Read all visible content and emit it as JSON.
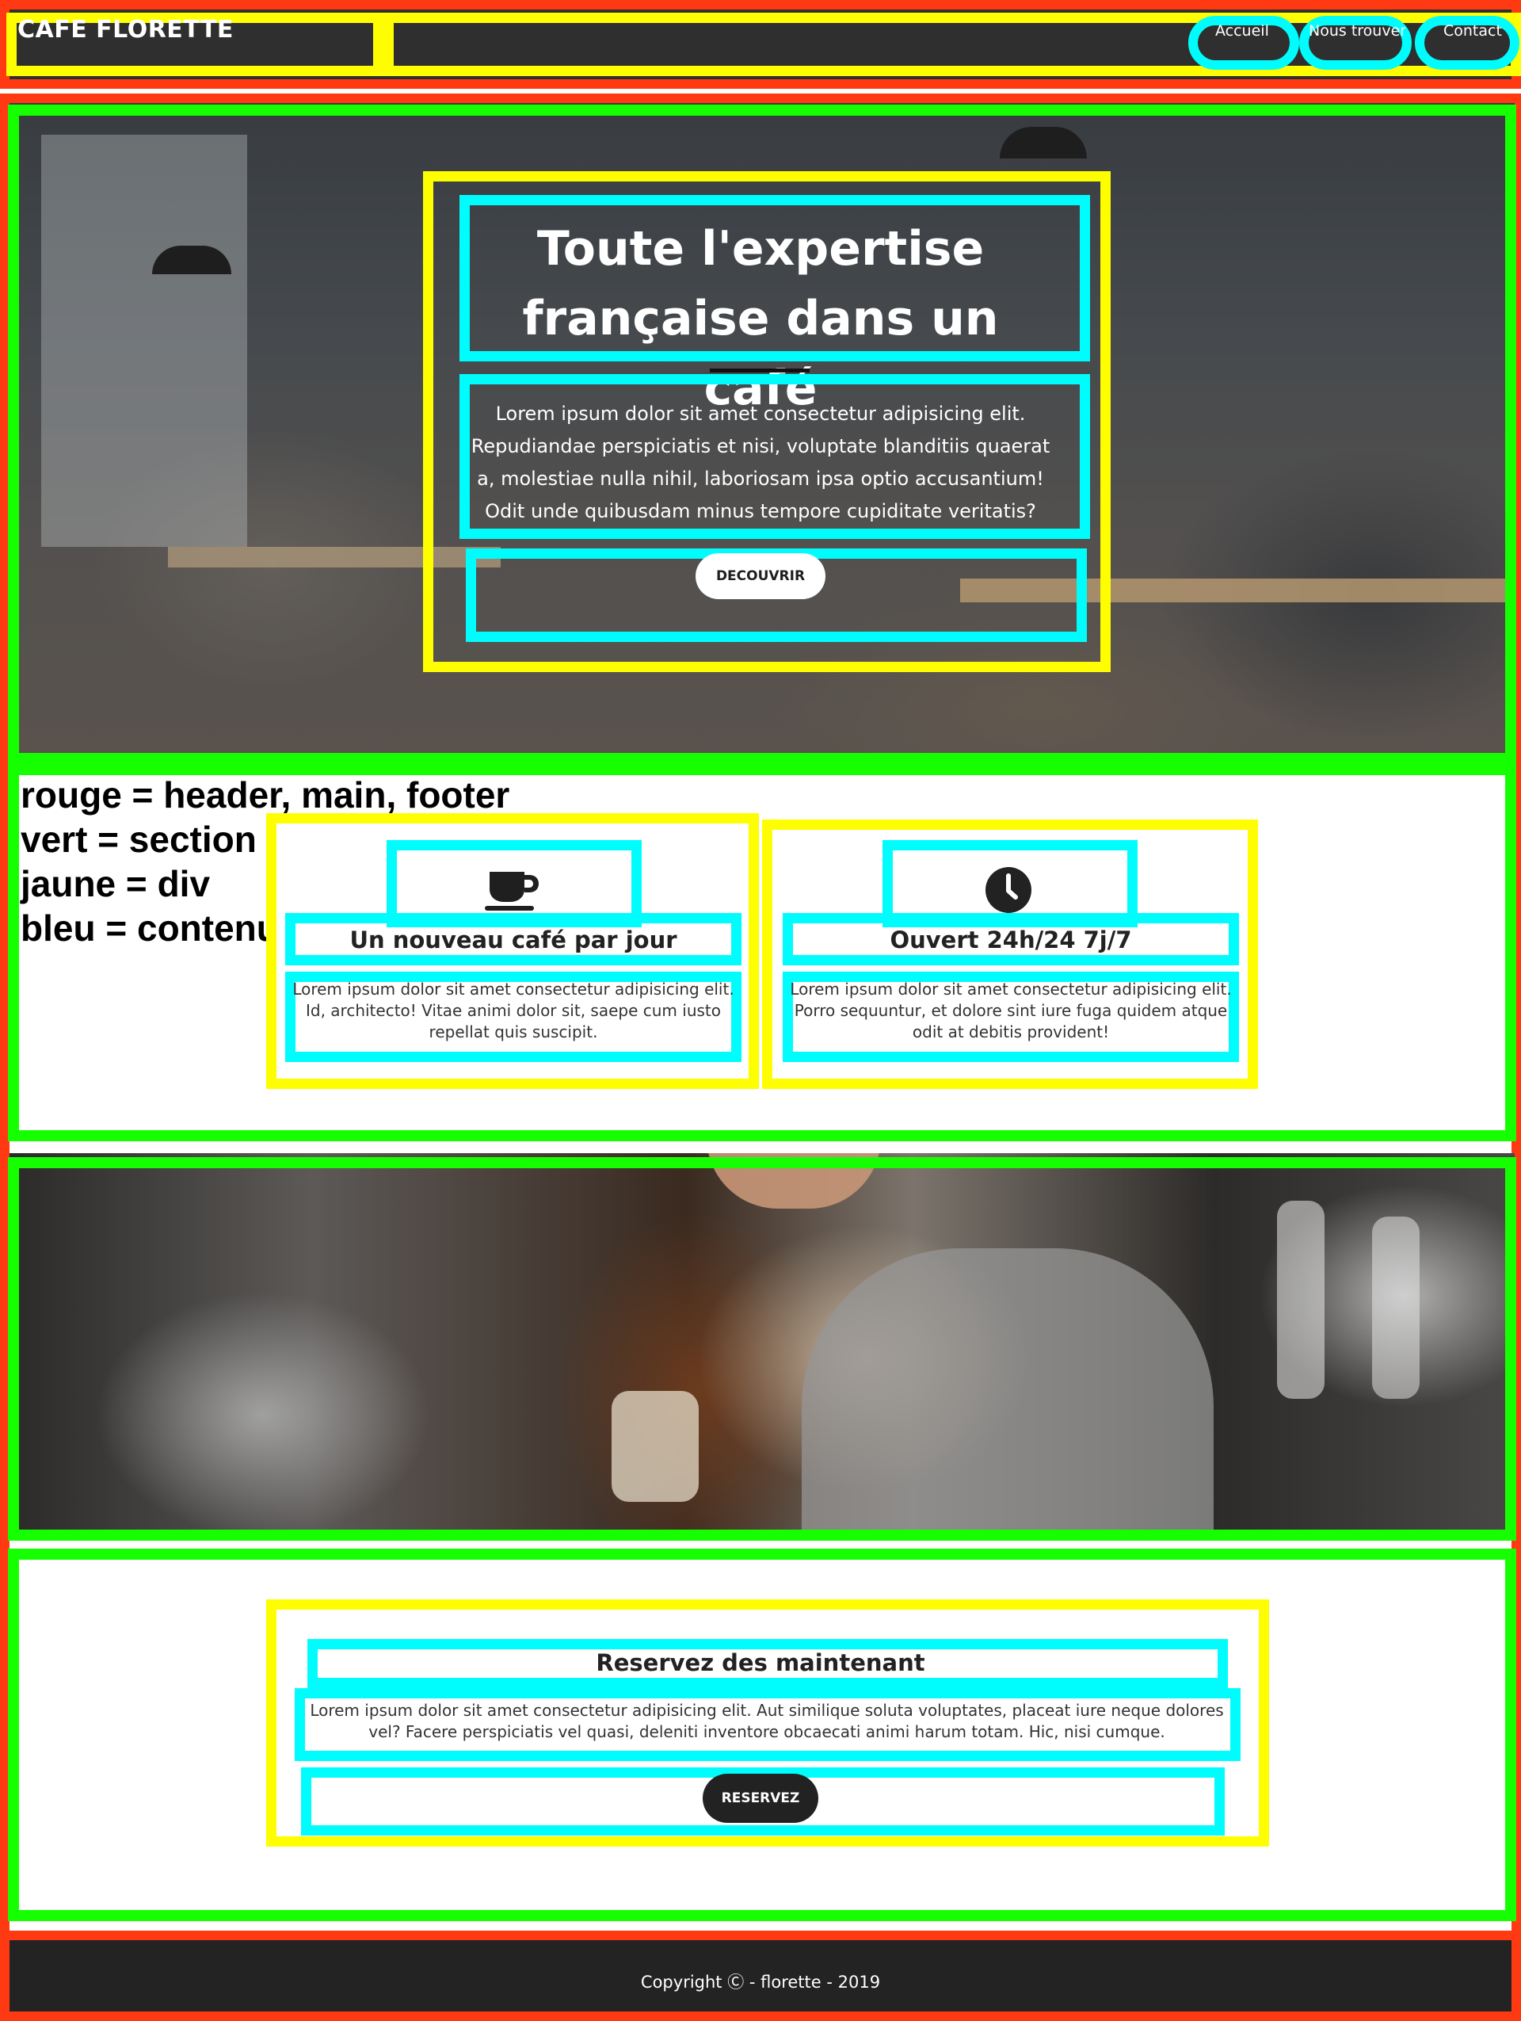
{
  "header": {
    "brand": "CAFE FLORETTE",
    "nav": [
      "Accueil",
      "Nous trouver",
      "Contact"
    ]
  },
  "hero": {
    "title": "Toute l'expertise française dans un café",
    "text": "Lorem ipsum dolor sit amet consectetur adipisicing elit. Repudiandae perspiciatis et nisi, voluptate blanditiis quaerat a, molestiae nulla nihil, laboriosam ipsa optio accusantium! Odit unde quibusdam minus tempore cupiditate veritatis?",
    "button": "DECOUVRIR"
  },
  "legend": {
    "red": "rouge = header, main, footer",
    "green": "vert = section",
    "yellow": "jaune = div",
    "blue": "bleu = contenu"
  },
  "features": [
    {
      "icon": "coffee-cup-icon",
      "title": "Un nouveau café par jour",
      "text": "Lorem ipsum dolor sit amet consectetur adipisicing elit. Id, architecto! Vitae animi dolor sit, saepe cum iusto repellat quis suscipit."
    },
    {
      "icon": "clock-icon",
      "title": "Ouvert 24h/24 7j/7",
      "text": "Lorem ipsum dolor sit amet consectetur adipisicing elit. Porro sequuntur, et dolore sint iure fuga quidem atque odit at debitis provident!"
    }
  ],
  "booking": {
    "title": "Reservez des maintenant",
    "text": "Lorem ipsum dolor sit amet consectetur adipisicing elit. Aut similique soluta voluptates, placeat iure neque dolores vel? Facere perspiciatis vel quasi, deleniti inventore obcaecati animi harum totam. Hic, nisi cumque.",
    "button": "RESERVEZ"
  },
  "footer": {
    "text": "Copyright Ⓒ - florette - 2019"
  },
  "colors": {
    "red": "#ff3a12",
    "green": "#16ff00",
    "yellow": "#fffe00",
    "cyan": "#00fdfd",
    "dark": "#2f2f2f"
  }
}
